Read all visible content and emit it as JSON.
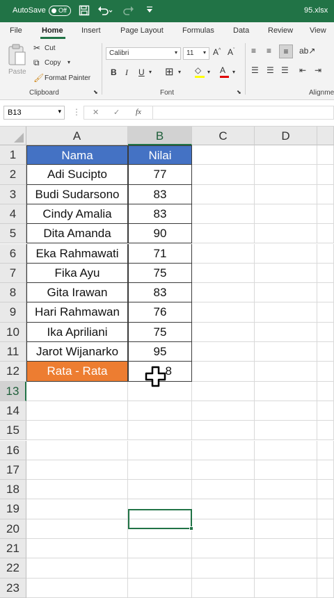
{
  "titlebar": {
    "autosave_label": "AutoSave",
    "autosave_state": "Off",
    "filename": "95.xlsx",
    "icons": [
      "save-icon",
      "undo-icon",
      "redo-icon",
      "customize-qat-icon"
    ]
  },
  "tabs": [
    "File",
    "Home",
    "Insert",
    "Page Layout",
    "Formulas",
    "Data",
    "Review",
    "View"
  ],
  "active_tab": "Home",
  "ribbon": {
    "paste_label": "Paste",
    "cut_label": "Cut",
    "copy_label": "Copy",
    "format_painter_label": "Format Painter",
    "clipboard_group": "Clipboard",
    "font_name": "Calibri",
    "font_size": "11",
    "font_group": "Font",
    "alignment_group": "Alignme"
  },
  "formula_bar": {
    "name_box": "B13",
    "fx_label": "fx",
    "formula": ""
  },
  "columns": [
    "A",
    "B",
    "C",
    "D"
  ],
  "selected_column": "B",
  "rows": [
    "1",
    "2",
    "3",
    "4",
    "5",
    "6",
    "7",
    "8",
    "9",
    "10",
    "11",
    "12",
    "13",
    "14",
    "15",
    "16",
    "17",
    "18",
    "19",
    "20",
    "21",
    "22",
    "23"
  ],
  "selected_row": "13",
  "table": {
    "header": [
      "Nama",
      "Nilai"
    ],
    "records": [
      [
        "Adi Sucipto",
        "77"
      ],
      [
        "Budi Sudarsono",
        "83"
      ],
      [
        "Cindy Amalia",
        "83"
      ],
      [
        "Dita Amanda",
        "90"
      ],
      [
        "Eka Rahmawati",
        "71"
      ],
      [
        "Fika Ayu",
        "75"
      ],
      [
        "Gita Irawan",
        "83"
      ],
      [
        "Hari Rahmawan",
        "76"
      ],
      [
        "Ika Apriliani",
        "75"
      ],
      [
        "Jarot Wijanarko",
        "95"
      ]
    ],
    "summary_label": "Rata - Rata",
    "summary_value_visible": "8"
  },
  "colors": {
    "excel_green": "#217346",
    "header_blue": "#4472c4",
    "summary_orange": "#ed7d31"
  }
}
